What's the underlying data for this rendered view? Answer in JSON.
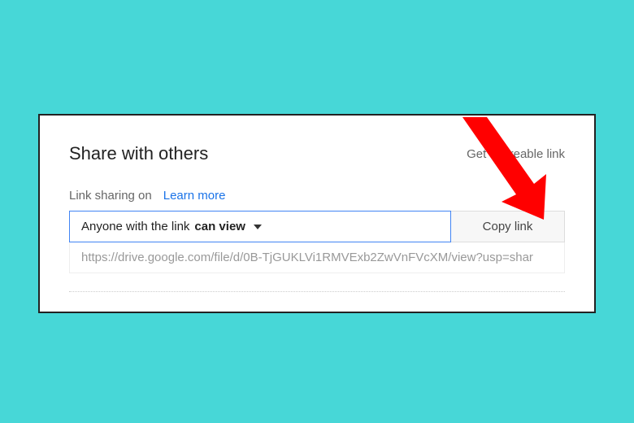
{
  "dialog": {
    "title": "Share with others",
    "shareable_link_label": "Get shareable link",
    "link_sharing_status": "Link sharing on",
    "learn_more_label": "Learn more",
    "permission": {
      "prefix": "Anyone with the link",
      "mode": "can view"
    },
    "copy_button_label": "Copy link",
    "url_value": "https://drive.google.com/file/d/0B-TjGUKLVi1RMVExb2ZwVnFVcXM/view?usp=shar"
  },
  "annotation": {
    "arrow_color": "#ff0000",
    "arrow_target": "copy-link-button"
  }
}
